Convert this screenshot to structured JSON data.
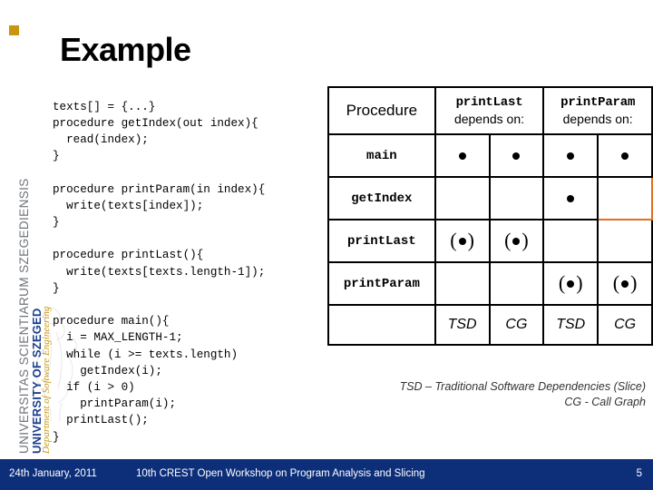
{
  "branding": {
    "latin_text": "UNIVERSITAS SCIENTIARUM SZEGEDIENSIS",
    "university": "UNIVERSITY OF SZEGED",
    "department": "Department of Software Engineering",
    "logo_color": "#c8960c",
    "university_color": "#1b3f8f"
  },
  "slide": {
    "title": "Example"
  },
  "code": {
    "text": "texts[] = {...}\nprocedure getIndex(out index){\n  read(index);\n}\n\nprocedure printParam(in index){\n  write(texts[index]);\n}\n\nprocedure printLast(){\n  write(texts[texts.length-1]);\n}\n\nprocedure main(){\n  i = MAX_LENGTH-1;\n  while (i >= texts.length)\n    getIndex(i);\n  if (i > 0)\n    printParam(i);\n  printLast();\n}"
  },
  "table": {
    "header": {
      "procedure_label": "Procedure",
      "groups": [
        {
          "name": "printLast",
          "suffix": "depends on:"
        },
        {
          "name": "printParam",
          "suffix": "depends on:"
        }
      ]
    },
    "rows": [
      {
        "label": "main",
        "cells": [
          "dot",
          "dot",
          "dot",
          "dot"
        ]
      },
      {
        "label": "getIndex",
        "cells": [
          "",
          "",
          "dot",
          ""
        ]
      },
      {
        "label": "printLast",
        "cells": [
          "pardot",
          "pardot",
          "",
          ""
        ]
      },
      {
        "label": "printParam",
        "cells": [
          "",
          "",
          "pardot",
          "pardot"
        ]
      }
    ],
    "subheader": {
      "label": "",
      "cells": [
        "TSD",
        "CG",
        "TSD",
        "CG"
      ]
    },
    "highlight": {
      "row": 1,
      "col": 3,
      "color": "#e07020"
    },
    "marks": {
      "dot": "●",
      "pardot_open": "(",
      "pardot_close": ")"
    }
  },
  "legend": {
    "line1": "TSD – Traditional Software Dependencies (Slice)",
    "line2": "CG - Call Graph"
  },
  "footer": {
    "date": "24th January, 2011",
    "event": "10th CREST Open Workshop on Program Analysis and Slicing",
    "page": "5",
    "bg_color": "#0d2f7a"
  }
}
